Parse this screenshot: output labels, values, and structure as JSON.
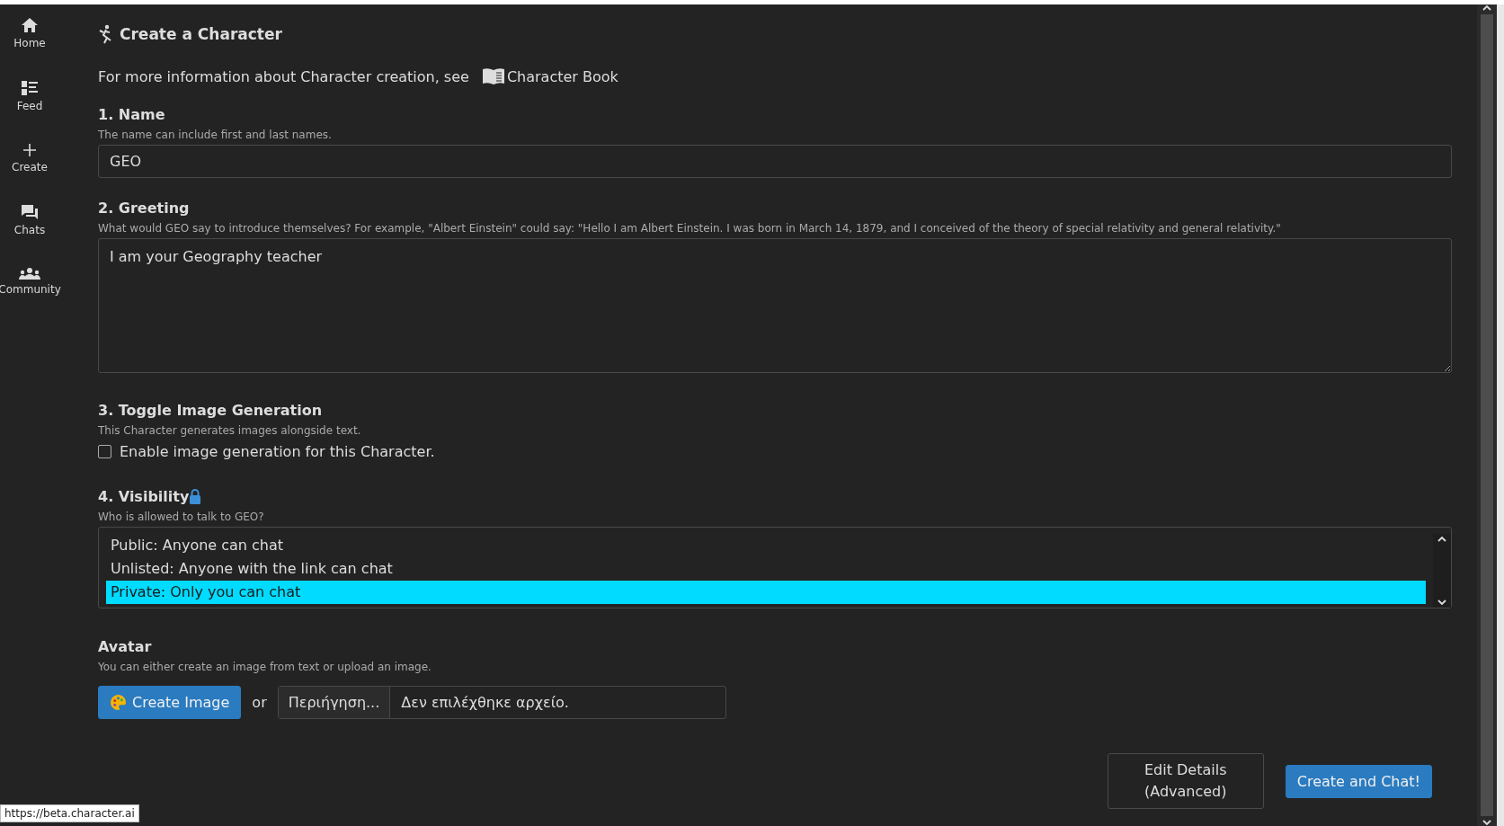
{
  "sidebar": {
    "items": [
      {
        "label": "Home"
      },
      {
        "label": "Feed"
      },
      {
        "label": "Create"
      },
      {
        "label": "Chats"
      },
      {
        "label": "Community"
      }
    ]
  },
  "page": {
    "title": "Create a Character",
    "info": "For more information about Character creation, see",
    "book_link": "Character Book"
  },
  "name": {
    "heading": "1. Name",
    "hint": "The name can include first and last names.",
    "value": "GEO"
  },
  "greeting": {
    "heading": "2. Greeting",
    "hint": "What would GEO say to introduce themselves? For example, \"Albert Einstein\" could say: \"Hello I am Albert Einstein. I was born in March 14, 1879, and I conceived of the theory of special relativity and general relativity.\"",
    "value": "I am your Geography teacher"
  },
  "image_generation": {
    "heading": "3. Toggle Image Generation",
    "hint": "This Character generates images alongside text.",
    "checkbox_label": "Enable image generation for this Character.",
    "checked": false
  },
  "visibility": {
    "heading": "4. Visibility",
    "hint": "Who is allowed to talk to GEO?",
    "options": [
      {
        "label": "Public: Anyone can chat",
        "selected": false
      },
      {
        "label": "Unlisted: Anyone with the link can chat",
        "selected": false
      },
      {
        "label": "Private: Only you can chat",
        "selected": true
      }
    ]
  },
  "avatar": {
    "heading": "Avatar",
    "hint": "You can either create an image from text or upload an image.",
    "create_button": "Create Image",
    "or": "or",
    "browse_button": "Περιήγηση...",
    "file_status": "Δεν επιλέχθηκε αρχείο."
  },
  "actions": {
    "edit_details": [
      "Edit Details",
      "(Advanced)"
    ],
    "create_and_chat": "Create and Chat!"
  },
  "status_bar": {
    "url": "https://beta.character.ai"
  }
}
